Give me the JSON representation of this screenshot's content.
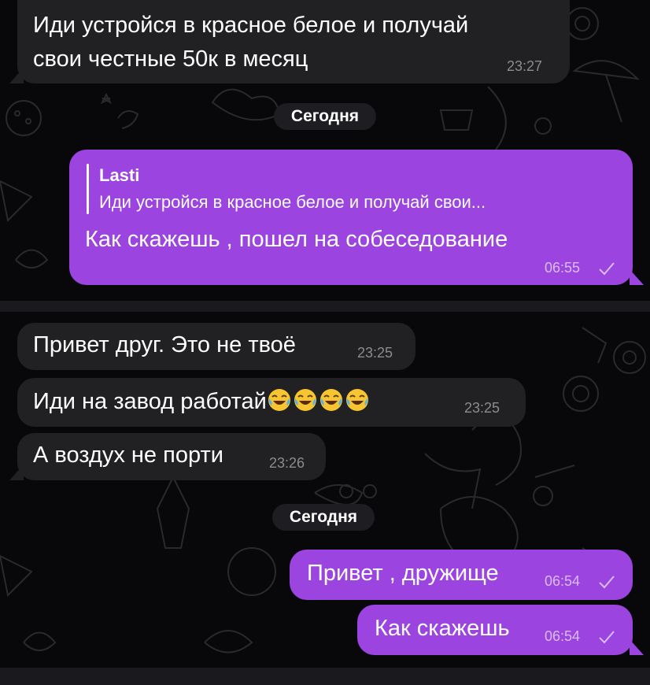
{
  "top": {
    "message_in": {
      "text": "Иди устройся в красное белое и получай\nсвои честные 50к в месяц",
      "line1": "Иди устройся в красное белое и получай",
      "line2": "свои честные 50к в месяц",
      "time": "23:27"
    },
    "date_label": "Сегодня",
    "message_out": {
      "reply_author": "Lasti",
      "reply_text": "Иди устройся в красное белое и получай свои...",
      "text": "Как скажешь , пошел на собеседование",
      "time": "06:55"
    }
  },
  "bottom": {
    "messages_in": [
      {
        "text": "Привет друг. Это не твоё",
        "time": "23:25"
      },
      {
        "text": "Иди на завод работай",
        "emoji": "😂😂😂😂",
        "time": "23:25"
      },
      {
        "text": "А воздух не порти",
        "time": "23:26"
      }
    ],
    "date_label": "Сегодня",
    "messages_out": [
      {
        "text": "Привет , дружище",
        "time": "06:54"
      },
      {
        "text": "Как скажешь",
        "time": "06:54"
      }
    ]
  },
  "colors": {
    "incoming_bubble": "#212123",
    "outgoing_bubble": "#9b44df",
    "background": "#08080a"
  },
  "icons": [
    "read-check-icon",
    "laughing-emoji-icon"
  ]
}
